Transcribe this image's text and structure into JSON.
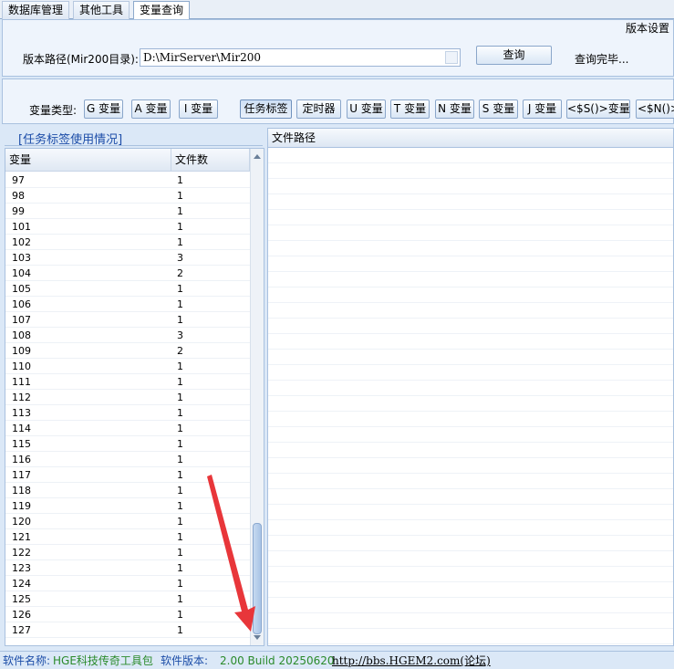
{
  "tabs": [
    {
      "label": "数据库管理"
    },
    {
      "label": "其他工具"
    },
    {
      "label": "变量查询"
    }
  ],
  "header": {
    "version_settings": "版本设置",
    "path_label": "版本路径(Mir200目录):",
    "path_value": "D:\\MirServer\\Mir200",
    "query_button": "查询",
    "query_status": "查询完毕..."
  },
  "var_types": {
    "label": "变量类型:",
    "buttons": [
      "G 变量",
      "A 变量",
      "I 变量",
      "任务标签",
      "定时器",
      "U 变量",
      "T 变量",
      "N 变量",
      "S 变量",
      "J 变量",
      "<$S()>变量",
      "<$N()>"
    ]
  },
  "list": {
    "title": "[任务标签使用情况]",
    "columns": [
      "变量",
      "文件数"
    ],
    "rows": [
      [
        "97",
        "1"
      ],
      [
        "98",
        "1"
      ],
      [
        "99",
        "1"
      ],
      [
        "101",
        "1"
      ],
      [
        "102",
        "1"
      ],
      [
        "103",
        "3"
      ],
      [
        "104",
        "2"
      ],
      [
        "105",
        "1"
      ],
      [
        "106",
        "1"
      ],
      [
        "107",
        "1"
      ],
      [
        "108",
        "3"
      ],
      [
        "109",
        "2"
      ],
      [
        "110",
        "1"
      ],
      [
        "111",
        "1"
      ],
      [
        "112",
        "1"
      ],
      [
        "113",
        "1"
      ],
      [
        "114",
        "1"
      ],
      [
        "115",
        "1"
      ],
      [
        "116",
        "1"
      ],
      [
        "117",
        "1"
      ],
      [
        "118",
        "1"
      ],
      [
        "119",
        "1"
      ],
      [
        "120",
        "1"
      ],
      [
        "121",
        "1"
      ],
      [
        "122",
        "1"
      ],
      [
        "123",
        "1"
      ],
      [
        "124",
        "1"
      ],
      [
        "125",
        "1"
      ],
      [
        "126",
        "1"
      ],
      [
        "127",
        "1"
      ]
    ]
  },
  "right": {
    "column": "文件路径"
  },
  "status": {
    "name_label": "软件名称:",
    "name_value": "HGE科技传奇工具包",
    "version_label": "软件版本:",
    "version_value": "2.00 Build 20250620",
    "link": "http://bbs.HGEM2.com(论坛)"
  },
  "colors": {
    "accent": "#1c4da8",
    "status_green": "#2a8a2a",
    "annotation_arrow": "#e8363a"
  }
}
